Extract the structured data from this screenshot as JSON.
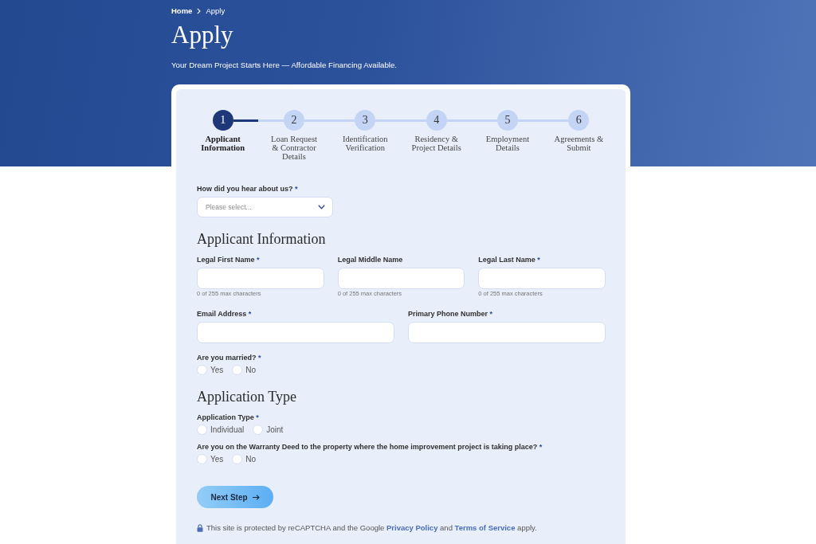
{
  "breadcrumb": [
    {
      "label": "Home",
      "current": false
    },
    {
      "label": "Apply",
      "current": true
    }
  ],
  "page": {
    "title": "Apply",
    "subtitle": "Your Dream Project Starts Here — Affordable Financing Available."
  },
  "stepper": {
    "level": 0.5,
    "steps": [
      {
        "number": "1",
        "label_lines": [
          "Applicant",
          "Information"
        ],
        "selected": true
      },
      {
        "number": "2",
        "label_lines": [
          "Loan Request",
          "& Contractor",
          "Details"
        ],
        "selected": false
      },
      {
        "number": "3",
        "label_lines": [
          "Identification",
          "Verification"
        ],
        "selected": false
      },
      {
        "number": "4",
        "label_lines": [
          "Residency &",
          "Project Details"
        ],
        "selected": false
      },
      {
        "number": "5",
        "label_lines": [
          "Employment",
          "Details"
        ],
        "selected": false
      },
      {
        "number": "6",
        "label_lines": [
          "Agreements &",
          "Submit"
        ],
        "selected": false
      }
    ]
  },
  "form_items": [
    {
      "kind": "select",
      "label": "How did you hear about us?",
      "required_mark": "*",
      "placeholder": "Please select..."
    },
    {
      "kind": "heading",
      "text": "Applicant Information"
    },
    {
      "kind": "text_row",
      "fields": [
        {
          "label": "Legal First Name",
          "required_mark": "*",
          "hint": "0 of 255 max characters"
        },
        {
          "label": "Legal Middle Name",
          "hint": "0 of 255 max characters"
        },
        {
          "label": "Legal Last Name",
          "required_mark": "*",
          "hint": "0 of 255 max characters"
        }
      ]
    },
    {
      "kind": "text_row",
      "fields": [
        {
          "label": "Email Address",
          "required_mark": "*"
        },
        {
          "label": "Primary Phone Number",
          "required_mark": "*"
        }
      ]
    },
    {
      "kind": "radio",
      "label": "Are you married?",
      "required_mark": "*",
      "options": [
        {
          "label": "Yes",
          "selected": false
        },
        {
          "label": "No",
          "selected": false
        }
      ]
    },
    {
      "kind": "heading",
      "text": "Application Type"
    },
    {
      "kind": "radio",
      "label": "Application Type",
      "required_mark": "*",
      "options": [
        {
          "label": "Individual",
          "selected": false
        },
        {
          "label": "Joint",
          "selected": false
        }
      ]
    },
    {
      "kind": "radio",
      "label": "Are you on the Warranty Deed to the property where the home improvement project is taking place?",
      "required_mark": "*",
      "options": [
        {
          "label": "Yes",
          "selected": false
        },
        {
          "label": "No",
          "selected": false
        }
      ]
    }
  ],
  "next_button": {
    "label": "Next Step"
  },
  "recaptcha_notice": [
    {
      "kind": "text",
      "text": "This site is protected by reCAPTCHA and the Google "
    },
    {
      "kind": "link",
      "text": "Privacy Policy"
    },
    {
      "kind": "text",
      "text": " and "
    },
    {
      "kind": "link",
      "text": "Terms of Service"
    },
    {
      "kind": "text",
      "text": " apply."
    }
  ]
}
